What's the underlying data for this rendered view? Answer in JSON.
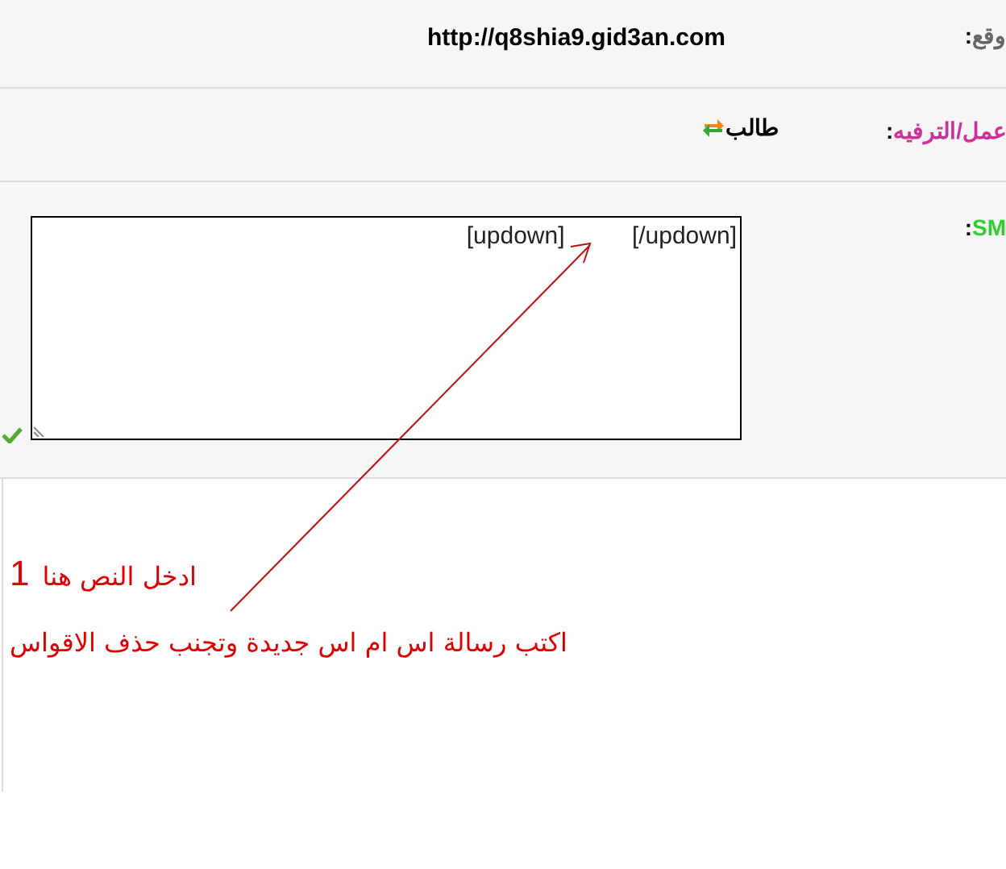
{
  "rows": [
    {
      "kind": "text",
      "label": "وقع",
      "colon": ":",
      "color": "#666666",
      "value": "http://q8shia9.gid3an.com"
    },
    {
      "kind": "status",
      "label": "عمل/الترفيه",
      "colon": ":",
      "color": "#cc3399",
      "value": "طالب"
    },
    {
      "kind": "message",
      "label": "SM",
      "colon": ":",
      "color": "#33cc33",
      "value": "[updown]          [/updown]"
    }
  ],
  "annotation": {
    "title": "ادخل النص هنا",
    "number": "1",
    "note": "اكتب رسالة اس ام اس جديدة وتجنب حذف الاقواس"
  }
}
